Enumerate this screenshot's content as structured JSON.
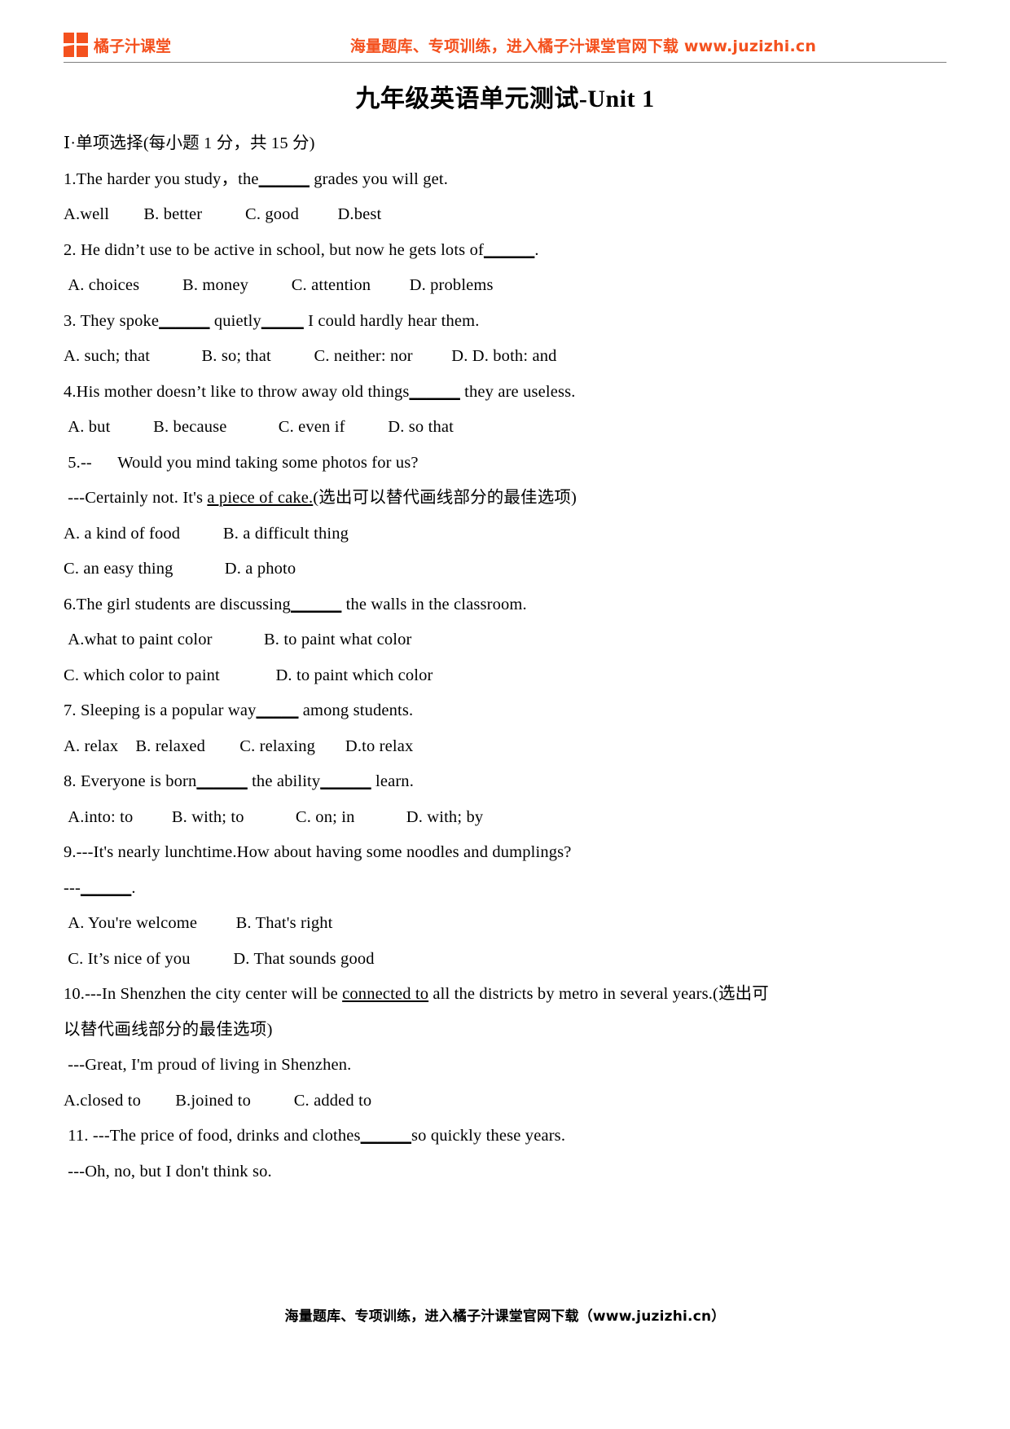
{
  "header": {
    "logo_icon": "four-square-grid-icon",
    "brand_name": "橘子汁课堂",
    "brand_color": "#F4511E",
    "slogan": "海量题库、专项训练，进入橘子汁课堂官网下载 www.juzizhi.cn"
  },
  "title": "九年级英语单元测试-Unit 1",
  "section": {
    "heading": "Ⅰ·单项选择(每小题 1 分，共 15 分)"
  },
  "questions": [
    {
      "stem_pre": "1.The harder you study，the",
      "blank": "______",
      "stem_post": " grades you will get.",
      "options_lines": [
        "A.well        B. better          C. good         D.best"
      ]
    },
    {
      "stem_pre": "2. He didn’t use to be active in school, but now he gets lots of",
      "blank": "______",
      "stem_post": ".",
      "options_lines": [
        " A. choices          B. money          C. attention         D. problems"
      ]
    },
    {
      "stem_pre": "3. They spoke",
      "blank": "______",
      "mid": " quietly",
      "blank2": "_____",
      "stem_post": " I could hardly hear them.",
      "options_lines": [
        "A. such; that            B. so; that          C. neither: nor         D. D. both: and"
      ]
    },
    {
      "stem_pre": "4.His mother doesn’t like to throw away old things",
      "blank": "______",
      "stem_post": " they are useless.",
      "options_lines": [
        " A. but          B. because            C. even if          D. so that"
      ]
    },
    {
      "stem_pre": " 5.--      Would you mind taking some photos for us?",
      "dialog_line": " ---Certainly not. It's ",
      "dialog_underlined": "a piece of cake.",
      "dialog_post": "(选出可以替代画线部分的最佳选项)",
      "options_lines": [
        "A. a kind of food          B. a difficult thing",
        "C. an easy thing            D. a photo"
      ]
    },
    {
      "stem_pre": "6.The girl students are discussing",
      "blank": "______",
      "stem_post": " the walls in the classroom.",
      "options_lines": [
        " A.what to paint color            B. to paint what color",
        "C. which color to paint             D. to paint which color"
      ]
    },
    {
      "stem_pre": "7. Sleeping is a popular way",
      "blank": "_____",
      "stem_post": " among students.",
      "options_lines": [
        "A. relax    B. relaxed        C. relaxing       D.to relax"
      ]
    },
    {
      "stem_pre": "8. Everyone is born",
      "blank": "______",
      "mid": " the ability",
      "blank2": "______",
      "stem_post": " learn.",
      "options_lines": [
        " A.into: to         B. with; to            C. on; in            D. with; by"
      ]
    },
    {
      "stem_pre": "9.---It's nearly lunchtime.How about having some noodles and dumplings?",
      "reply_pre": "---",
      "reply_blank": "______",
      "reply_post": ".",
      "options_lines": [
        " A. You're welcome         B. That's right",
        " C. It’s nice of you          D. That sounds good"
      ]
    },
    {
      "stem_pre": "10.---In Shenzhen the city center will be ",
      "stem_underlined": "connected to",
      "stem_post": " all the districts by metro in several years.(选出可",
      "stem_line2": "以替代画线部分的最佳选项)",
      "reply": " ---Great, I'm proud of living in Shenzhen.",
      "options_lines": [
        "A.closed to        B.joined to          C. added to"
      ]
    },
    {
      "stem_pre": " 11. ---The price of food, drinks and clothes",
      "blank": "______",
      "stem_post": "so quickly these years.",
      "reply": " ---Oh, no, but I don't think so."
    }
  ],
  "footer": {
    "text": "海量题库、专项训练，进入橘子汁课堂官网下载（www.juzizhi.cn）"
  }
}
